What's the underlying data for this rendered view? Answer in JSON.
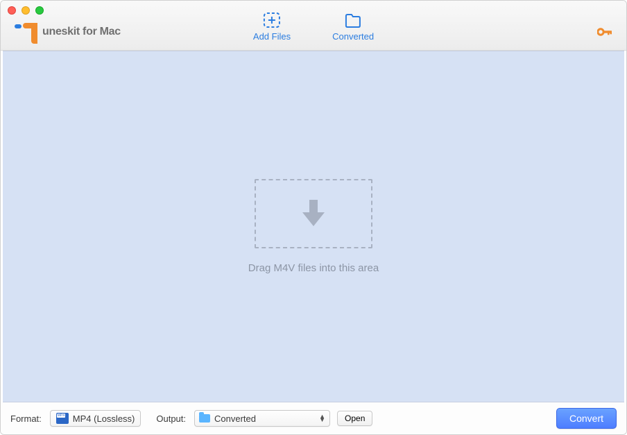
{
  "app": {
    "logo_text": "uneskit for Mac"
  },
  "toolbar": {
    "add_files_label": "Add Files",
    "converted_label": "Converted"
  },
  "main": {
    "drop_hint": "Drag M4V files into this area"
  },
  "footer": {
    "format_label": "Format:",
    "format_value": "MP4 (Lossless)",
    "output_label": "Output:",
    "output_value": "Converted",
    "open_label": "Open",
    "convert_label": "Convert"
  }
}
